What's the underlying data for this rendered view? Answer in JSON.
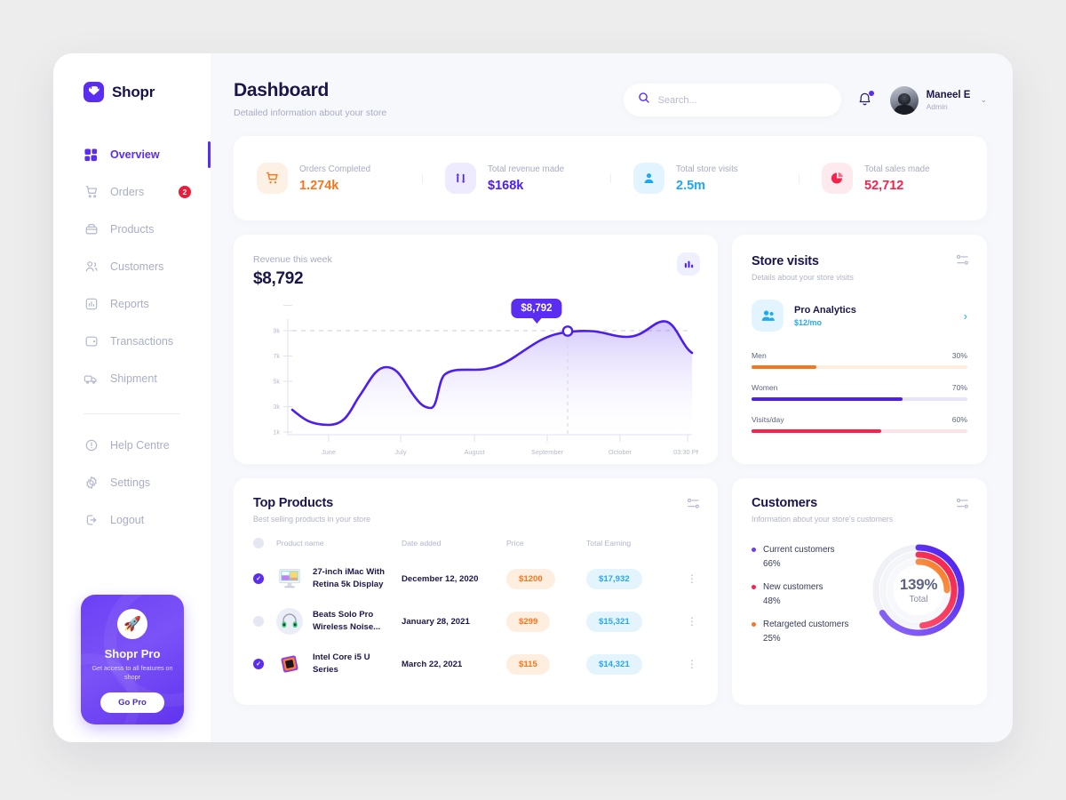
{
  "brand": {
    "name": "Shopr",
    "logo_icon": "shopping-bag-icon"
  },
  "sidebar": {
    "items": [
      {
        "label": "Overview",
        "icon": "grid-icon",
        "active": true,
        "badge": ""
      },
      {
        "label": "Orders",
        "icon": "cart-icon",
        "active": false,
        "badge": "2"
      },
      {
        "label": "Products",
        "icon": "box-icon",
        "active": false,
        "badge": ""
      },
      {
        "label": "Customers",
        "icon": "users-icon",
        "active": false,
        "badge": ""
      },
      {
        "label": "Reports",
        "icon": "bar-chart-icon",
        "active": false,
        "badge": ""
      },
      {
        "label": "Transactions",
        "icon": "wallet-icon",
        "active": false,
        "badge": ""
      },
      {
        "label": "Shipment",
        "icon": "truck-icon",
        "active": false,
        "badge": ""
      }
    ],
    "footer_items": [
      {
        "label": "Help Centre",
        "icon": "info-circle-icon"
      },
      {
        "label": "Settings",
        "icon": "gear-icon"
      },
      {
        "label": "Logout",
        "icon": "logout-icon"
      }
    ],
    "pro_card": {
      "icon": "rocket-icon",
      "title": "Shopr Pro",
      "subtitle": "Get access to all features on shopr",
      "button": "Go Pro"
    }
  },
  "header": {
    "title": "Dashboard",
    "subtitle": "Detailed information about your store",
    "search": {
      "placeholder": "Search...",
      "value": "",
      "icon": "search-icon"
    },
    "bell_icon": "bell-icon",
    "user": {
      "name": "Maneel E",
      "role": "Admin",
      "chevron": "⌄"
    }
  },
  "stats": [
    {
      "label": "Orders Completed",
      "value": "1.274k",
      "icon": "cart-icon",
      "color": "#f6761e",
      "bg": "#fdf1e6"
    },
    {
      "label": "Total revenue made",
      "value": "$168k",
      "icon": "transfer-arrows-icon",
      "color": "#4c1ef0",
      "bg": "#eeeaff"
    },
    {
      "label": "Total store visits",
      "value": "2.5m",
      "icon": "person-icon",
      "color": "#1ba9f5",
      "bg": "#e2f4ff"
    },
    {
      "label": "Total sales made",
      "value": "52,712",
      "icon": "pie-chart-icon",
      "color": "#f5224b",
      "bg": "#fdeaee"
    }
  ],
  "revenue_card": {
    "label": "Revenue this week",
    "value": "$8,792",
    "chart_button_icon": "bar-chart-icon",
    "tooltip": "$8,792"
  },
  "store_visits": {
    "title": "Store visits",
    "subtitle": "Details about your store visits",
    "menu_icon": "sliders-icon",
    "promo": {
      "icon": "users-icon",
      "title": "Pro Analytics",
      "price": "$12/mo",
      "chevron_icon": "chevron-right-icon"
    },
    "bars": [
      {
        "label": "Men",
        "pct": "30%",
        "value": 30,
        "color": "#f6761e",
        "track": "#fdeede"
      },
      {
        "label": "Women",
        "pct": "70%",
        "value": 70,
        "color": "#4c1ef0",
        "track": "#e7e3fb"
      },
      {
        "label": "Visits/day",
        "pct": "60%",
        "value": 60,
        "color": "#f5224b",
        "track": "#fde3e9"
      }
    ]
  },
  "top_products": {
    "title": "Top Products",
    "subtitle": "Best selling products in your store",
    "menu_icon": "sliders-icon",
    "columns": [
      "Product name",
      "Date added",
      "Price",
      "Total Earning"
    ],
    "rows": [
      {
        "checked": true,
        "thumb": "imac-icon",
        "name": "27-inch iMac With Retina 5k Display",
        "date": "December 12, 2020",
        "price": "$1200",
        "earning": "$17,932",
        "menu": "⋮"
      },
      {
        "checked": false,
        "thumb": "headphones-icon",
        "name": "Beats Solo Pro Wireless Noise...",
        "date": "January 28, 2021",
        "price": "$299",
        "earning": "$15,321",
        "menu": "⋮"
      },
      {
        "checked": true,
        "thumb": "cpu-chip-icon",
        "name": "Intel Core i5 U Series",
        "date": "March 22, 2021",
        "price": "$115",
        "earning": "$14,321",
        "menu": "⋮"
      }
    ]
  },
  "customers": {
    "title": "Customers",
    "subtitle": "Information about your store's customers",
    "menu_icon": "sliders-icon",
    "legend": [
      {
        "label": "Current customers",
        "pct": "66%",
        "color": "#6b3df2"
      },
      {
        "label": "New customers",
        "pct": "48%",
        "color": "#f5224b"
      },
      {
        "label": "Retargeted customers",
        "pct": "25%",
        "color": "#f6761e"
      }
    ],
    "donut_value": "139%",
    "donut_total": "Total"
  },
  "chart_data": {
    "type": "area",
    "title": "Revenue this week",
    "xlabel": "",
    "ylabel": "",
    "ylim": [
      0,
      10000
    ],
    "yticks": [
      "1k",
      "3k",
      "5k",
      "7k",
      "9k"
    ],
    "ytick_values": [
      1000,
      3000,
      5000,
      7000,
      9000
    ],
    "xticks": [
      "June",
      "July",
      "August",
      "September",
      "October",
      "03:30 PM"
    ],
    "grid": false,
    "legend": "none",
    "line_color": "#4c1ef0",
    "fill": "purple-gradient",
    "highlight": {
      "label": "$8,792",
      "value": 8792,
      "x_index": 4.35
    },
    "series": [
      {
        "name": "Revenue",
        "points": [
          {
            "x": 0.0,
            "y": 2800
          },
          {
            "x": 0.3,
            "y": 2200
          },
          {
            "x": 0.55,
            "y": 2150
          },
          {
            "x": 0.9,
            "y": 3300
          },
          {
            "x": 1.15,
            "y": 5600
          },
          {
            "x": 1.45,
            "y": 4400
          },
          {
            "x": 1.75,
            "y": 3250
          },
          {
            "x": 1.95,
            "y": 4600
          },
          {
            "x": 2.1,
            "y": 6400
          },
          {
            "x": 2.55,
            "y": 6450
          },
          {
            "x": 3.0,
            "y": 7350
          },
          {
            "x": 3.6,
            "y": 8550
          },
          {
            "x": 4.0,
            "y": 8820
          },
          {
            "x": 4.35,
            "y": 8800
          },
          {
            "x": 4.8,
            "y": 8500
          },
          {
            "x": 5.2,
            "y": 8600
          },
          {
            "x": 5.55,
            "y": 9450
          },
          {
            "x": 5.9,
            "y": 8900
          },
          {
            "x": 6.2,
            "y": 8050
          }
        ]
      }
    ]
  }
}
